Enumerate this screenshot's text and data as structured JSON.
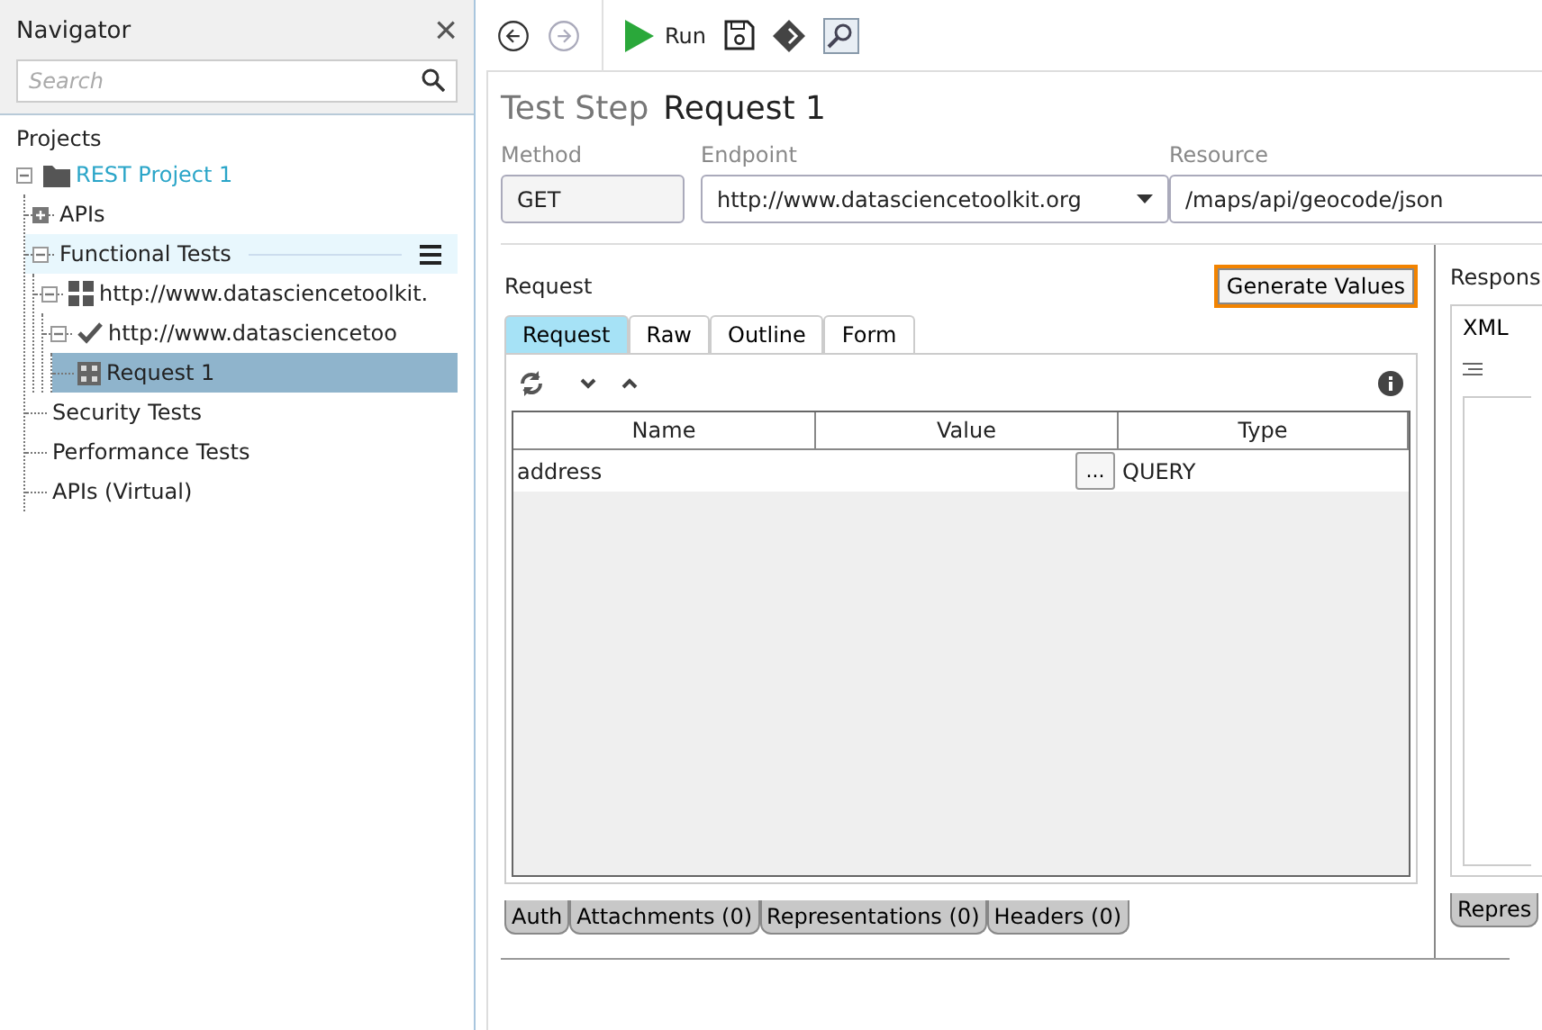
{
  "navigator": {
    "title": "Navigator",
    "close": "×",
    "search": {
      "placeholder": "Search"
    },
    "section": "Projects",
    "tree": [
      {
        "label": "REST Project 1",
        "kind": "project",
        "expanded": true,
        "selected": false,
        "hovered": false,
        "children": [
          {
            "label": "APIs",
            "expanded": false,
            "selected": false,
            "hovered": false
          },
          {
            "label": "Functional Tests",
            "expanded": true,
            "selected": false,
            "hovered": true,
            "children": [
              {
                "label": "http://www.datasciencetoolkit.",
                "kind": "suite",
                "expanded": true,
                "selected": false,
                "hovered": false,
                "children": [
                  {
                    "label": "http://www.datasciencetoo",
                    "kind": "case",
                    "expanded": true,
                    "selected": false,
                    "hovered": false,
                    "children": [
                      {
                        "label": "Request 1",
                        "kind": "request",
                        "selected": true,
                        "hovered": false
                      }
                    ]
                  }
                ]
              }
            ]
          },
          {
            "label": "Security Tests",
            "selected": false,
            "hovered": false
          },
          {
            "label": "Performance Tests",
            "selected": false,
            "hovered": false
          },
          {
            "label": "APIs (Virtual)",
            "selected": false,
            "hovered": false
          }
        ]
      }
    ]
  },
  "toolbar": {
    "back_disabled": false,
    "forward_disabled": true,
    "run": "Run"
  },
  "step": {
    "prefix": "Test Step",
    "name": "Request 1"
  },
  "fields": [
    {
      "label": "Method",
      "value": "GET",
      "kind": "plain"
    },
    {
      "label": "Endpoint",
      "value": "http://www.datasciencetoolkit.org",
      "kind": "dropdown"
    },
    {
      "label": "Resource",
      "value": "/maps/api/geocode/json",
      "kind": "plain"
    }
  ],
  "request": {
    "title": "Request",
    "generate": "Generate Values",
    "tabs": [
      {
        "label": "Request",
        "selected": true
      },
      {
        "label": "Raw",
        "selected": false
      },
      {
        "label": "Outline",
        "selected": false
      },
      {
        "label": "Form",
        "selected": false
      }
    ],
    "table": {
      "columns": [
        "Name",
        "Value",
        "Type"
      ],
      "rows": [
        {
          "name": "address",
          "value_button": "...",
          "type": "QUERY"
        }
      ]
    },
    "bottom_tabs": [
      "Auth",
      "Attachments (0)",
      "Representations (0)",
      "Headers (0)"
    ]
  },
  "response": {
    "title": "Respons",
    "tab": "XML",
    "bottom_tab": "Repres"
  }
}
